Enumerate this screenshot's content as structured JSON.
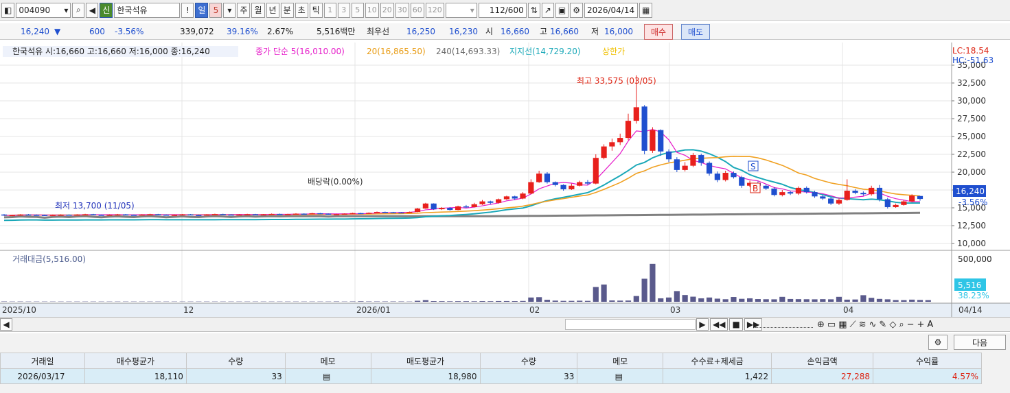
{
  "toolbar": {
    "code": "004090",
    "credit_badge": "신",
    "stock_name": "한국석유",
    "alert": "!",
    "period_day": "일",
    "period_num": "5",
    "period_week": "주",
    "period_month": "월",
    "period_year": "년",
    "period_minute": "분",
    "period_second": "초",
    "period_tick": "틱",
    "intervals": [
      "1",
      "3",
      "5",
      "10",
      "20",
      "30",
      "60",
      "120"
    ],
    "count": "112",
    "count_total": "/600",
    "date": "2026/04/14"
  },
  "quote": {
    "price": "16,240",
    "arrow": "▼",
    "change": "600",
    "change_pct": "-3.56%",
    "volume": "339,072",
    "volume_ratio": "39.16%",
    "turnover": "2.67%",
    "amount": "5,516백만",
    "bid_label": "최우선",
    "bid1": "16,250",
    "bid2": "16,230",
    "open_label": "시",
    "open": "16,660",
    "high_label": "고",
    "high": "16,660",
    "low_label": "저",
    "low": "16,000",
    "buy_button": "매수",
    "sell_button": "매도"
  },
  "legend": {
    "stock": "한국석유 시:16,660 고:16,660 저:16,000 종:16,240",
    "ma5": "종가 단순 5(16,010.00)",
    "ma20": "20(16,865.50)",
    "ma240": "240(14,693.33)",
    "support": "지지선(14,729.20)",
    "limit": "상한가"
  },
  "price_axis": {
    "labels": [
      "35,000",
      "32,500",
      "30,000",
      "27,500",
      "25,000",
      "22,500",
      "20,000",
      "17,500",
      "15,000",
      "12,500",
      "10,000"
    ],
    "lc": "LC:18.54",
    "hc": "HC:-51.63",
    "current": "16,240",
    "current_pct": "-3.56%"
  },
  "annotations": {
    "high": "최고 33,575 (03/05)",
    "low": "최저 13,700 (11/05)",
    "dividend": "배당락(0.00%)",
    "sell_mark": "S",
    "buy_mark": "B"
  },
  "volume_panel": {
    "title": "거래대금(5,516.00)",
    "axis_top": "500,000",
    "current": "5,516",
    "current_pct": "38.23%"
  },
  "dates": [
    "2025/10",
    "12",
    "2026/01",
    "02",
    "03",
    "04",
    "04/14"
  ],
  "trades": {
    "next_button": "다음",
    "headers": [
      "거래일",
      "매수평균가",
      "수량",
      "메모",
      "매도평균가",
      "수량",
      "메모",
      "수수료+제세금",
      "손익금액",
      "수익률"
    ],
    "rows": [
      [
        "2026/03/17",
        "18,110",
        "33",
        "",
        "18,980",
        "33",
        "",
        "1,422",
        "27,288",
        "4.57%"
      ]
    ]
  },
  "colors": {
    "up": "#e8201c",
    "down": "#1f4fcf",
    "ma5": "#e51bc9",
    "ma20": "#f0a020",
    "ma240": "#808080",
    "support": "#1aa8b8",
    "volume": "#5a5a8c"
  },
  "chart_data": {
    "type": "candlestick",
    "ylim": [
      8000,
      36000
    ],
    "candles": [
      [
        14060,
        13940,
        14120,
        13880
      ],
      [
        13940,
        13980,
        14040,
        13870
      ],
      [
        13980,
        14060,
        14110,
        13900
      ],
      [
        14060,
        14020,
        14130,
        13970
      ],
      [
        14020,
        14000,
        14080,
        13950
      ],
      [
        14000,
        13900,
        14050,
        13850
      ],
      [
        13900,
        14000,
        14060,
        13870
      ],
      [
        14000,
        14040,
        14100,
        13960
      ],
      [
        14040,
        13980,
        14090,
        13920
      ],
      [
        13980,
        14060,
        14110,
        13930
      ],
      [
        14060,
        14100,
        14160,
        14010
      ],
      [
        14100,
        14020,
        14150,
        13970
      ],
      [
        14020,
        13960,
        14070,
        13900
      ],
      [
        13960,
        14040,
        14090,
        13910
      ],
      [
        14040,
        14080,
        14140,
        14000
      ],
      [
        14080,
        14020,
        14130,
        13980
      ],
      [
        14020,
        13980,
        14060,
        13930
      ],
      [
        13980,
        14060,
        14110,
        13950
      ],
      [
        14060,
        14100,
        14170,
        14010
      ],
      [
        14100,
        14040,
        14150,
        13990
      ],
      [
        14040,
        13960,
        14090,
        13910
      ],
      [
        13960,
        14020,
        14070,
        13920
      ],
      [
        14020,
        14080,
        14130,
        13980
      ],
      [
        14080,
        14000,
        14130,
        13950
      ],
      [
        14000,
        13980,
        14060,
        13930
      ],
      [
        13980,
        14060,
        14110,
        13940
      ],
      [
        14060,
        14120,
        14180,
        14020
      ],
      [
        14120,
        14060,
        14170,
        14010
      ],
      [
        14060,
        14000,
        14110,
        13950
      ],
      [
        14000,
        14060,
        14120,
        13960
      ],
      [
        14060,
        14100,
        14160,
        14020
      ],
      [
        14100,
        14040,
        14150,
        13990
      ],
      [
        14040,
        14080,
        14130,
        14000
      ],
      [
        14080,
        14140,
        14200,
        14040
      ],
      [
        14140,
        14080,
        14190,
        14030
      ],
      [
        14080,
        14120,
        14170,
        14040
      ],
      [
        14120,
        14180,
        14240,
        14090
      ],
      [
        14180,
        14120,
        14230,
        14070
      ],
      [
        14120,
        14240,
        14300,
        14090
      ],
      [
        14240,
        14180,
        14290,
        14130
      ],
      [
        14180,
        14060,
        14220,
        14010
      ],
      [
        14060,
        14120,
        14170,
        14020
      ],
      [
        14120,
        14180,
        14230,
        14080
      ],
      [
        14180,
        14260,
        14320,
        14140
      ],
      [
        14260,
        14200,
        14310,
        14150
      ],
      [
        14200,
        14300,
        14360,
        14170
      ],
      [
        14300,
        14420,
        14480,
        14260
      ],
      [
        14420,
        14380,
        14470,
        14330
      ],
      [
        14380,
        14360,
        14430,
        14310
      ],
      [
        14360,
        14300,
        14410,
        14250
      ],
      [
        14300,
        14420,
        14480,
        14280
      ],
      [
        14420,
        14900,
        15000,
        14380
      ],
      [
        14900,
        15600,
        15700,
        14860
      ],
      [
        15600,
        14800,
        15640,
        14700
      ],
      [
        14800,
        15000,
        15100,
        14700
      ],
      [
        15000,
        14700,
        15100,
        14600
      ],
      [
        14700,
        15200,
        15300,
        14650
      ],
      [
        15200,
        15100,
        15400,
        15000
      ],
      [
        15100,
        15500,
        15700,
        15050
      ],
      [
        15500,
        15900,
        16100,
        15400
      ],
      [
        15900,
        15700,
        16000,
        15500
      ],
      [
        15700,
        16200,
        16300,
        15600
      ],
      [
        16200,
        16600,
        16700,
        16100
      ],
      [
        16600,
        16300,
        16700,
        16100
      ],
      [
        16300,
        17000,
        17200,
        16200
      ],
      [
        17000,
        18600,
        19000,
        16900
      ],
      [
        18600,
        19800,
        20200,
        18500
      ],
      [
        19800,
        18600,
        20000,
        18400
      ],
      [
        18600,
        18200,
        18700,
        18000
      ],
      [
        18200,
        17600,
        18300,
        17400
      ],
      [
        17600,
        18100,
        18400,
        17500
      ],
      [
        18100,
        18600,
        18800,
        18000
      ],
      [
        18600,
        18400,
        18900,
        18200
      ],
      [
        18400,
        22000,
        22500,
        18300
      ],
      [
        22000,
        23600,
        23900,
        21800
      ],
      [
        23600,
        24200,
        24700,
        23000
      ],
      [
        24200,
        24800,
        25400,
        23800
      ],
      [
        24800,
        27200,
        28200,
        24500
      ],
      [
        27200,
        29100,
        33575,
        26800
      ],
      [
        29200,
        23000,
        29400,
        22500
      ],
      [
        23000,
        25900,
        26300,
        22700
      ],
      [
        25900,
        22900,
        26000,
        22300
      ],
      [
        22900,
        21800,
        23200,
        21400
      ],
      [
        21800,
        20300,
        22100,
        20000
      ],
      [
        20300,
        20900,
        21400,
        20100
      ],
      [
        20900,
        22400,
        22700,
        20700
      ],
      [
        22400,
        21300,
        22600,
        20900
      ],
      [
        21300,
        19800,
        21500,
        19500
      ],
      [
        19800,
        18900,
        20100,
        18600
      ],
      [
        18900,
        19900,
        20200,
        18700
      ],
      [
        19900,
        19300,
        20100,
        19100
      ],
      [
        19300,
        18100,
        19500,
        17800
      ],
      [
        18100,
        18500,
        18800,
        17900
      ],
      [
        18500,
        18100,
        18700,
        17800
      ],
      [
        18100,
        17700,
        18300,
        17500
      ],
      [
        17700,
        16800,
        17900,
        16600
      ],
      [
        16800,
        17200,
        17500,
        16600
      ],
      [
        17200,
        17000,
        17400,
        16800
      ],
      [
        17000,
        17800,
        18000,
        16800
      ],
      [
        17800,
        17200,
        18000,
        17000
      ],
      [
        17200,
        16600,
        17400,
        16400
      ],
      [
        16600,
        16300,
        16800,
        16100
      ],
      [
        16300,
        15600,
        16500,
        15400
      ],
      [
        15600,
        16100,
        16300,
        15400
      ],
      [
        16100,
        17400,
        19000,
        16000
      ],
      [
        17400,
        17100,
        17600,
        16900
      ],
      [
        17100,
        16900,
        17300,
        16700
      ],
      [
        16900,
        17800,
        18100,
        16700
      ],
      [
        17800,
        16200,
        18200,
        15900
      ],
      [
        16200,
        15100,
        16400,
        14900
      ],
      [
        15100,
        15400,
        15600,
        15000
      ],
      [
        15400,
        15900,
        16100,
        15300
      ],
      [
        15900,
        16700,
        16900,
        15800
      ],
      [
        16660,
        16240,
        16660,
        16000
      ]
    ],
    "volume": [
      40,
      30,
      35,
      30,
      30,
      30,
      30,
      30,
      30,
      30,
      30,
      30,
      30,
      30,
      30,
      30,
      30,
      30,
      30,
      30,
      30,
      30,
      30,
      30,
      30,
      30,
      30,
      30,
      30,
      30,
      30,
      30,
      30,
      30,
      30,
      30,
      30,
      30,
      30,
      30,
      30,
      40,
      30,
      40,
      60,
      40,
      40,
      40,
      40,
      40,
      30,
      120,
      200,
      80,
      70,
      60,
      70,
      70,
      60,
      80,
      70,
      90,
      90,
      80,
      100,
      520,
      560,
      240,
      140,
      110,
      110,
      130,
      110,
      1800,
      2100,
      160,
      140,
      150,
      700,
      2800,
      4600,
      420,
      520,
      1300,
      820,
      620,
      420,
      520,
      380,
      310,
      580,
      360,
      420,
      330,
      310,
      300,
      600,
      340,
      320,
      310,
      300,
      320,
      300,
      600,
      260,
      280,
      800,
      480,
      350,
      300,
      210,
      200,
      260,
      220,
      200
    ]
  }
}
